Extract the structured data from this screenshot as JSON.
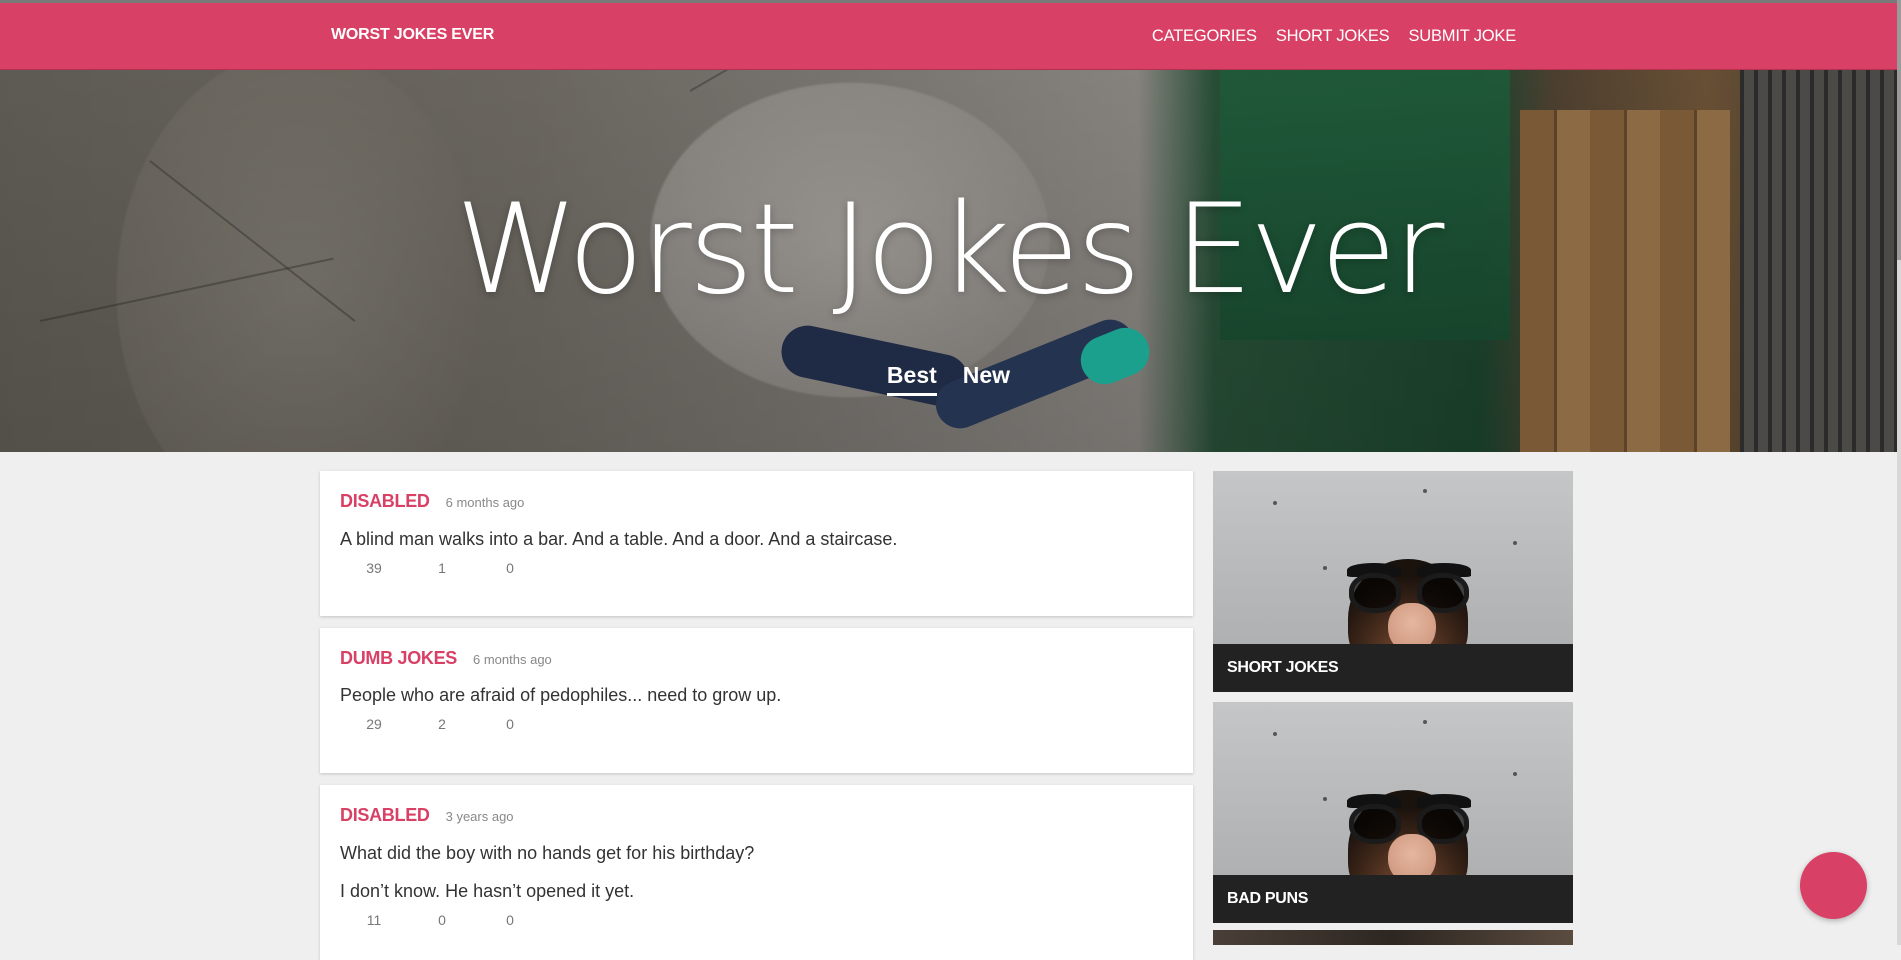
{
  "header": {
    "brand": "WORST JOKES EVER",
    "nav": [
      "CATEGORIES",
      "SHORT JOKES",
      "SUBMIT JOKE"
    ],
    "accent_color": "#d94065"
  },
  "hero": {
    "title": "Worst Jokes Ever",
    "tabs": [
      {
        "label": "Best",
        "active": true
      },
      {
        "label": "New",
        "active": false
      }
    ]
  },
  "jokes": [
    {
      "category": "DISABLED",
      "time": "6 months ago",
      "lines": [
        "A blind man walks into a bar. And a table. And a door. And a staircase."
      ],
      "stats": [
        "39",
        "1",
        "0"
      ]
    },
    {
      "category": "DUMB JOKES",
      "time": "6 months ago",
      "lines": [
        "People who are afraid of pedophiles... need to grow up."
      ],
      "stats": [
        "29",
        "2",
        "0"
      ]
    },
    {
      "category": "DISABLED",
      "time": "3 years ago",
      "lines": [
        "What did the boy with no hands get for his birthday?",
        "I don’t know. He hasn’t opened it yet."
      ],
      "stats": [
        "11",
        "0",
        "0"
      ]
    }
  ],
  "sidebar": {
    "categories": [
      "SHORT JOKES",
      "BAD PUNS"
    ]
  }
}
